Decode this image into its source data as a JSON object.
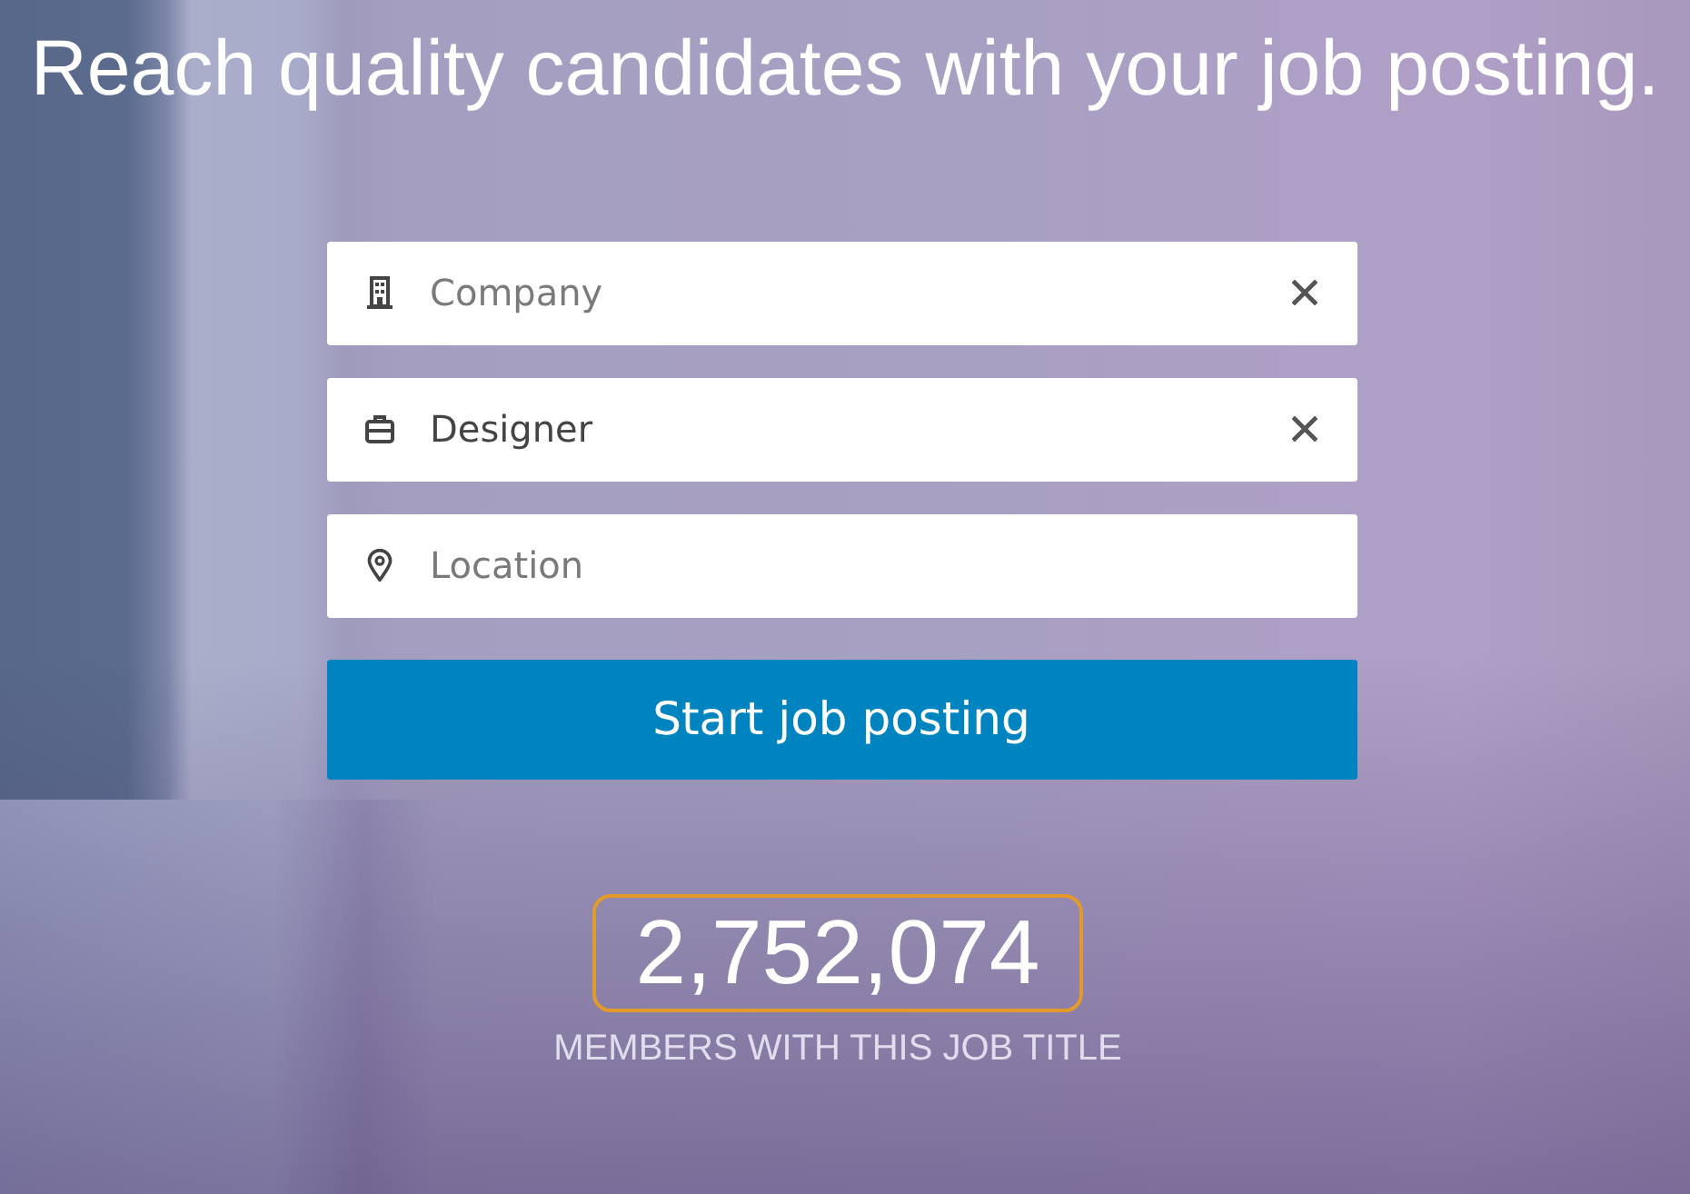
{
  "heading": "Reach quality candidates with your job posting.",
  "fields": [
    {
      "kind": "company",
      "placeholder": "Company",
      "clearable": true
    },
    {
      "kind": "job_title",
      "value": "Designer",
      "clearable": true
    },
    {
      "kind": "location",
      "placeholder": "Location",
      "clearable": false
    }
  ],
  "submit_button": "Start job posting",
  "member_count": {
    "value": "2,752,074",
    "highlighted": true,
    "caption": "MEMBERS WITH THIS JOB TITLE"
  }
}
